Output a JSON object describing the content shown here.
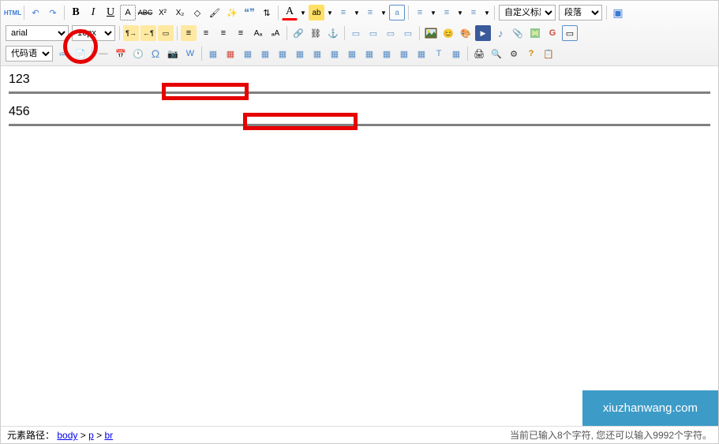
{
  "toolbar": {
    "html_label": "HTML",
    "font_family": "arial",
    "font_size": "16px",
    "code_lang": "代码语言",
    "heading_style": "自定义标题",
    "paragraph": "段落"
  },
  "icons": {
    "undo": "↶",
    "redo": "↷",
    "bold": "B",
    "italic": "I",
    "underline": "U",
    "fontborder": "A",
    "strike": "ABC",
    "sup": "X²",
    "sub": "X₂",
    "eraser": "◇",
    "brush": "🖌",
    "magic": "✨",
    "quote": "❝❞",
    "fontcase": "⇅",
    "forecolor": "A",
    "backcolor": "ab",
    "ol": "≡",
    "ul": "≡",
    "a_box": "a",
    "indent_l": "←",
    "indent_r": "→",
    "outdent": "⇤",
    "indent": "⇥",
    "fullscreen": "▣",
    "dir_ltr": "¶→",
    "dir_rtl": "←¶",
    "dir_box": "▭",
    "align_l": "≡",
    "align_c": "≡",
    "align_r": "≡",
    "align_j": "≡",
    "touppercase": "Aₐ",
    "tolowercase": "ₐA",
    "link": "🔗",
    "unlink": "⛓",
    "anchor": "⚓",
    "img_l": "▭",
    "img_r": "▭",
    "img_c": "▭",
    "img_n": "▭",
    "img": "🖼",
    "emoji": "😊",
    "palette": "🎨",
    "video": "▶",
    "music": "♪",
    "attach": "📎",
    "map": "🗺",
    "gmap": "G",
    "iframe": "▭",
    "code_btn": "≔",
    "template": "📄",
    "pagebreak": "⫞",
    "date": "📅",
    "time": "🕐",
    "omega": "Ω",
    "spechar": "Ω",
    "snap": "📷",
    "tbl": "▦",
    "tbl_del": "▦",
    "tbl_ins_row": "▦",
    "tbl_ins_col": "▦",
    "tbl_del_row": "▦",
    "tbl_del_col": "▦",
    "tbl_merge": "▦",
    "tbl_split": "▦",
    "tbl_caption": "T",
    "tbl_title": "▦",
    "print": "🖨",
    "search": "🔍",
    "preview": "👁",
    "help": "?",
    "drafts": "📋"
  },
  "content": {
    "line1": "123",
    "line2": "456"
  },
  "statusbar": {
    "path_label": "元素路径：",
    "path_body": "body",
    "path_p": "p",
    "path_br": "br",
    "sep": " > ",
    "right": "当前已输入8个字符, 您还可以输入9992个字符。"
  },
  "watermark": "xiuzhanwang.com"
}
